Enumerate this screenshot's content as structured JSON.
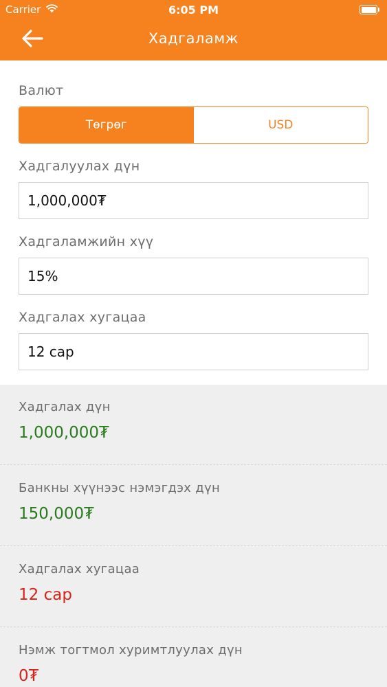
{
  "status_bar": {
    "carrier": "Carrier",
    "time": "6:05 PM"
  },
  "header": {
    "title": "Хадгаламж",
    "back_icon": "arrow-left-icon"
  },
  "form": {
    "currency_label": "Валют",
    "currency_options": [
      "Төгрөг",
      "USD"
    ],
    "currency_selected": "Төгрөг",
    "amount_label": "Хадгалуулах дүн",
    "amount_value": "1,000,000₮",
    "interest_label": "Хадгаламжийн хүү",
    "interest_value": "15%",
    "term_label": "Хадгалах хугацаа",
    "term_value": "12 сар"
  },
  "results": [
    {
      "label": "Хадгалах дүн",
      "value": "1,000,000₮"
    },
    {
      "label": "Банкны хүүнээс нэмэгдэх дүн",
      "value": "150,000₮"
    },
    {
      "label": "Хадгалах хугацаа",
      "value": "12 сар"
    },
    {
      "label": "Нэмж тогтмол хуримтлуулах дүн",
      "value": "0₮"
    }
  ],
  "colors": {
    "accent": "#f5821f",
    "value_green": "#2a7a1e",
    "value_red": "#d9241b"
  }
}
